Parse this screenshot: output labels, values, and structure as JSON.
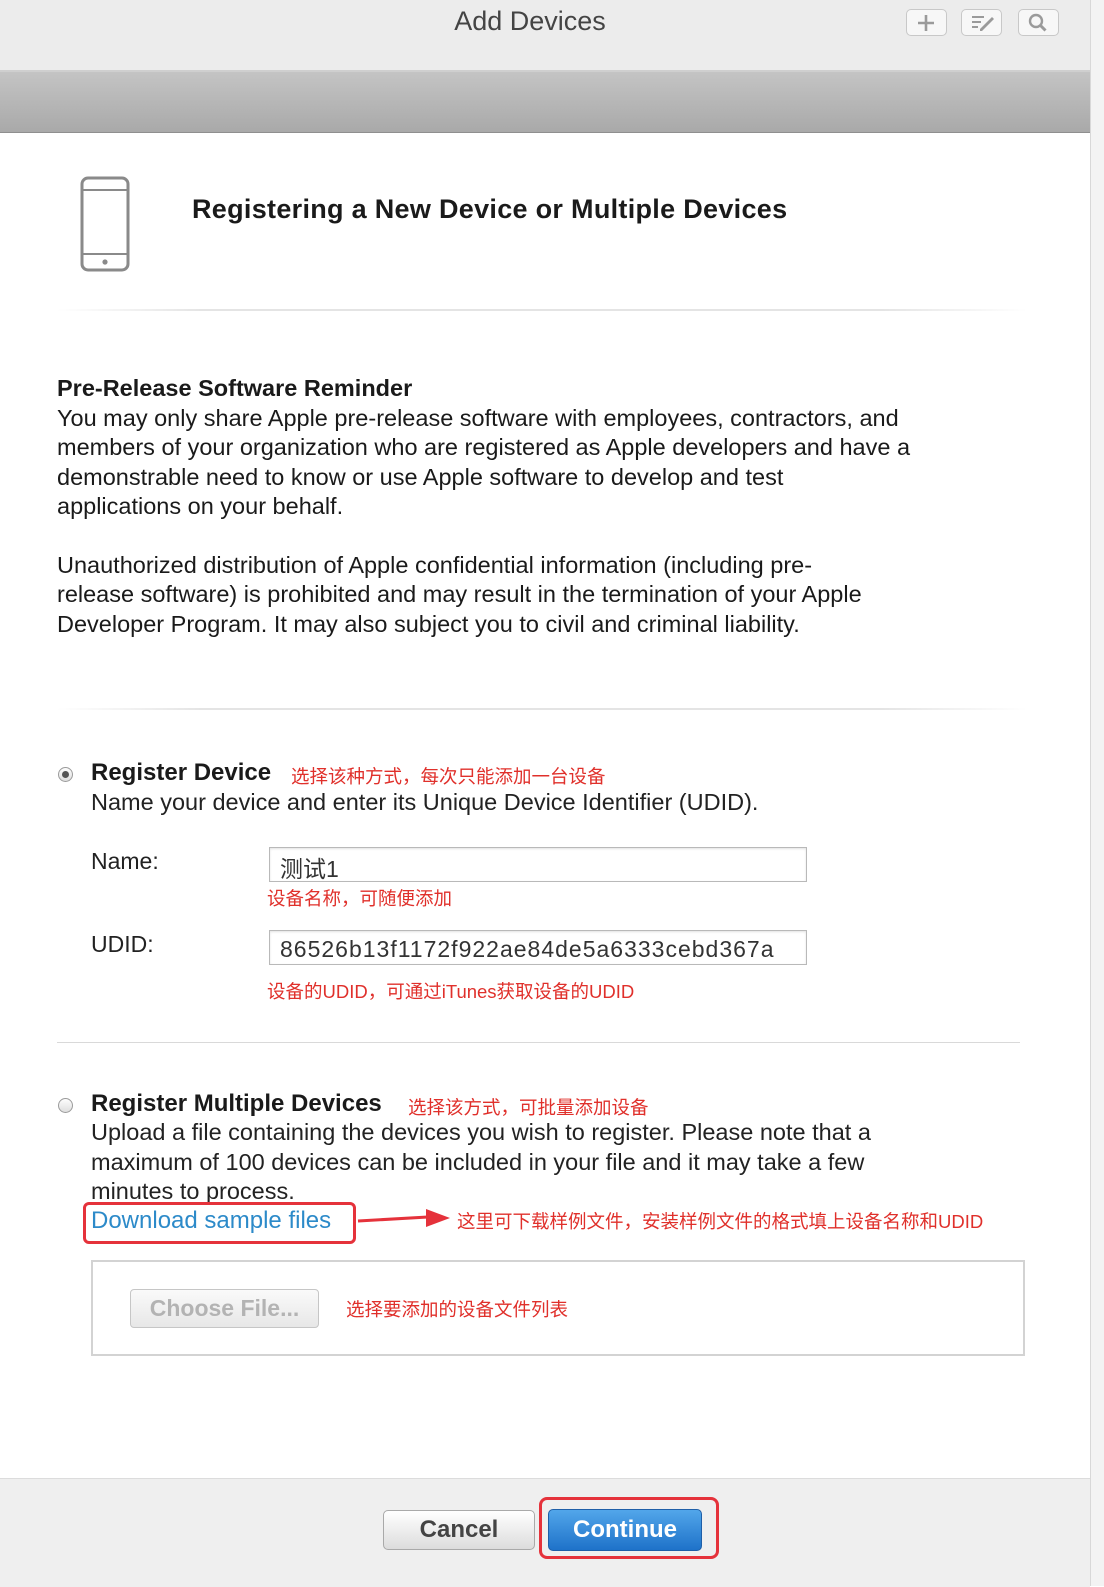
{
  "window": {
    "title": "Add Devices",
    "toolbar_icons": [
      "plus-icon",
      "edit-icon",
      "search-icon"
    ]
  },
  "header": {
    "icon": "iphone-icon",
    "heading": "Registering a New Device or Multiple Devices"
  },
  "reminder": {
    "title": "Pre-Release Software Reminder",
    "lines1": [
      "You may only share Apple pre-release software with employees, contractors, and",
      "members of your organization who are registered as Apple developers and have a",
      "demonstrable need to know or use Apple software to develop and test",
      "applications on your behalf."
    ],
    "lines2": [
      "Unauthorized distribution of Apple confidential information (including pre-",
      "release software) is prohibited and may result in the termination of your Apple",
      "Developer Program. It may also subject you to civil and criminal liability."
    ]
  },
  "register_device": {
    "title": "Register Device",
    "annotation": "选择该种方式，每次只能添加一台设备",
    "description": "Name your device and enter its Unique Device Identifier (UDID).",
    "name_label": "Name:",
    "name_value": "测试1",
    "name_annotation": "设备名称，可随便添加",
    "udid_label": "UDID:",
    "udid_value": "86526b13f1172f922ae84de5a6333cebd367a",
    "udid_annotation": "设备的UDID，可通过iTunes获取设备的UDID",
    "selected": true
  },
  "register_multiple": {
    "title": "Register Multiple Devices",
    "annotation": "选择该方式，可批量添加设备",
    "description_lines": [
      "Upload a file containing the devices you wish to register. Please note that a",
      "maximum of 100 devices can be included in your file and it may take a few",
      "minutes to process."
    ],
    "download_link": "Download sample files",
    "download_annotation": "这里可下载样例文件，安装样例文件的格式填上设备名称和UDID",
    "choose_file_button": "Choose File...",
    "choose_file_annotation": "选择要添加的设备文件列表",
    "selected": false
  },
  "footer": {
    "cancel_label": "Cancel",
    "continue_label": "Continue"
  },
  "colors": {
    "annotation_red": "#e0302b",
    "link_blue": "#2c8ac9",
    "primary_button": "#1e72c9"
  }
}
